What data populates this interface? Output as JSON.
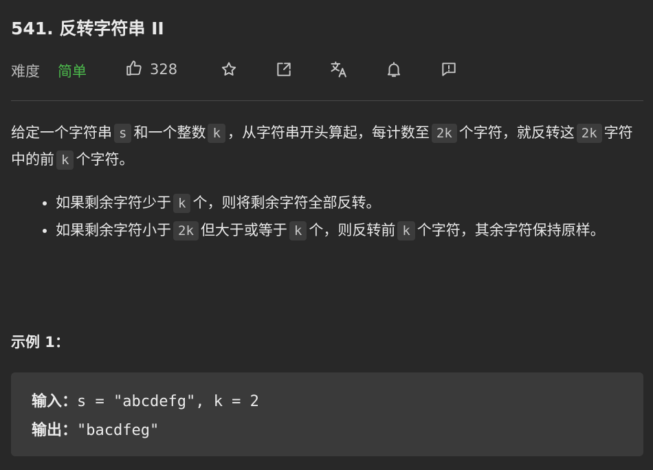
{
  "problem": {
    "title": "541. 反转字符串 II",
    "difficulty_label": "难度",
    "difficulty": "简单",
    "likes": "328"
  },
  "toolbar_icons": [
    "thumbs-up-icon",
    "star-icon",
    "share-icon",
    "translate-icon",
    "bell-icon",
    "feedback-icon"
  ],
  "colors": {
    "background": "#282828",
    "difficulty_easy": "#4cba4c",
    "code_background": "#3c3c3c",
    "example_background": "#3a3a3a"
  },
  "description": {
    "p1_a": "给定一个字符串",
    "p1_code_s": "s",
    "p1_b": "和一个整数",
    "p1_code_k": "k",
    "p1_c": "，从字符串开头算起，每计数至",
    "p1_code_2k": "2k",
    "p1_d": "个字符，就反转这",
    "p1_code_2k_b": "2k",
    "p1_e": "字符中的前",
    "p1_code_k_b": "k",
    "p1_f": "个字符。",
    "rule1_a": "如果剩余字符少于",
    "rule1_code_k": "k",
    "rule1_b": "个，则将剩余字符全部反转。",
    "rule2_a": "如果剩余字符小于",
    "rule2_code_2k": "2k",
    "rule2_b": "但大于或等于",
    "rule2_code_k": "k",
    "rule2_c": "个，则反转前",
    "rule2_code_k_b": "k",
    "rule2_d": "个字符，其余字符保持原样。"
  },
  "example1": {
    "title": "示例 1：",
    "input_label": "输入：",
    "input_value": "s = \"abcdefg\", k = 2",
    "output_label": "输出：",
    "output_value": "\"bacdfeg\""
  }
}
